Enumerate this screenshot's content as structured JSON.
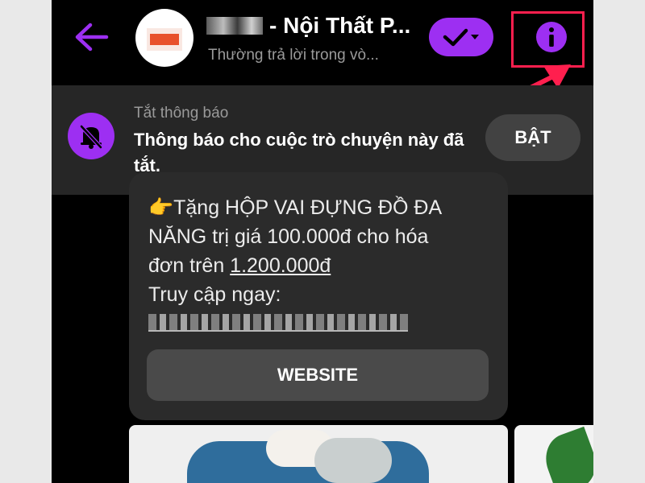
{
  "header": {
    "title": "- Nội Thất P...",
    "subtitle": "Thường trả lời trong vò..."
  },
  "notice": {
    "heading": "Tắt thông báo",
    "text": "Thông báo cho cuộc trò chuyện này đã tắt.",
    "button_label": "BẬT"
  },
  "message": {
    "line1": "👉Tặng HỘP VAI ĐỰNG ĐỒ ĐA",
    "line2_prefix": "NĂNG trị giá 100.000đ cho hóa",
    "line3_prefix": "đơn trên ",
    "line3_price": "1.200.000đ",
    "line4": "Truy cập ngay:",
    "button_label": "WEBSITE"
  },
  "colors": {
    "accent": "#9d2ff2",
    "highlight": "#ff1f4e",
    "background": "#000000",
    "bubble": "#2b2b2b"
  },
  "icons": {
    "back": "arrow-left-icon",
    "check": "checkmark-icon",
    "dropdown": "chevron-down-icon",
    "info": "info-icon",
    "muted": "bell-off-icon"
  }
}
